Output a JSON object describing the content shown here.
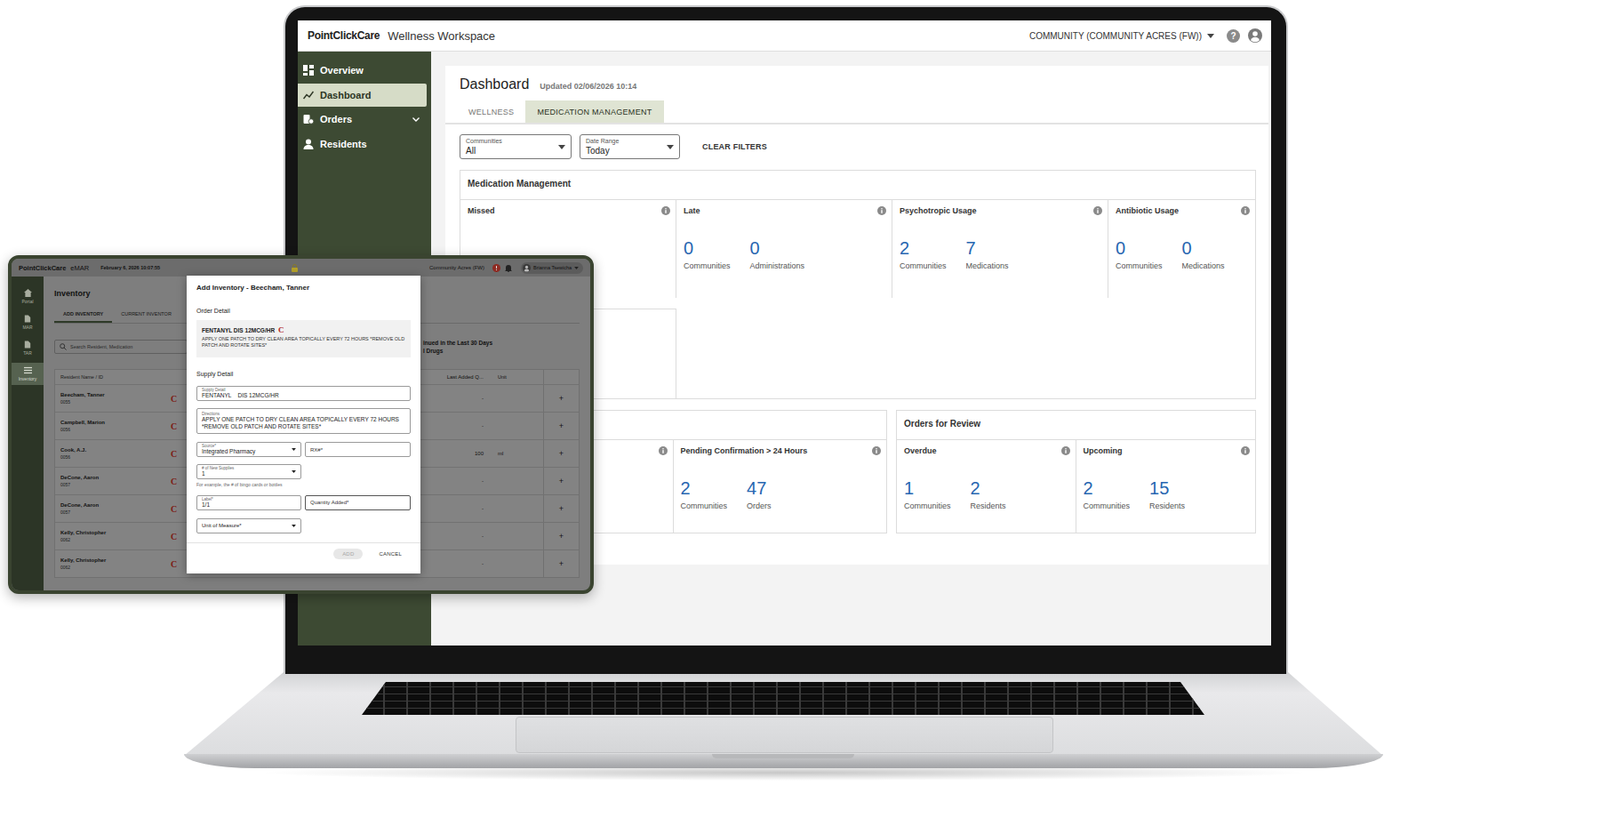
{
  "laptop": {
    "topbar": {
      "brand": "PointClickCare",
      "app": "Wellness Workspace",
      "community": "COMMUNITY (COMMUNITY ACRES (FW))",
      "help": "?"
    },
    "sidebar": {
      "items": [
        {
          "label": "Overview",
          "selected": false,
          "expandable": false
        },
        {
          "label": "Dashboard",
          "selected": true,
          "expandable": false
        },
        {
          "label": "Orders",
          "selected": false,
          "expandable": true
        },
        {
          "label": "Residents",
          "selected": false,
          "expandable": false
        }
      ]
    },
    "dashboard": {
      "title": "Dashboard",
      "updated": "Updated 02/06/2026 10:14",
      "tabs": [
        {
          "label": "WELLNESS",
          "selected": false
        },
        {
          "label": "MEDICATION MANAGEMENT",
          "selected": true
        }
      ],
      "filters": [
        {
          "label": "Communities",
          "value": "All"
        },
        {
          "label": "Date Range",
          "value": "Today"
        }
      ],
      "clear_filters": "CLEAR FILTERS",
      "medication_card": {
        "title": "Medication Management",
        "metrics": [
          {
            "title": "Missed",
            "stats": []
          },
          {
            "title": "Late",
            "stats": [
              {
                "value": "0",
                "label": "Communities"
              },
              {
                "value": "0",
                "label": "Administrations"
              }
            ]
          },
          {
            "title": "Psychotropic Usage",
            "stats": [
              {
                "value": "2",
                "label": "Communities"
              },
              {
                "value": "7",
                "label": "Medications"
              }
            ]
          },
          {
            "title": "Antibiotic Usage",
            "stats": [
              {
                "value": "0",
                "label": "Communities"
              },
              {
                "value": "0",
                "label": "Medications"
              }
            ]
          }
        ]
      },
      "pending_card": {
        "metrics": [
          {
            "title": "Pending Confirmation > 24 Hours",
            "stats": [
              {
                "value": "2",
                "label": "Communities"
              },
              {
                "value": "47",
                "label": "Orders"
              }
            ]
          }
        ]
      },
      "orders_card": {
        "title": "Orders for Review",
        "metrics": [
          {
            "title": "Overdue",
            "stats": [
              {
                "value": "1",
                "label": "Communities"
              },
              {
                "value": "2",
                "label": "Residents"
              }
            ]
          },
          {
            "title": "Upcoming",
            "stats": [
              {
                "value": "2",
                "label": "Communities"
              },
              {
                "value": "15",
                "label": "Residents"
              }
            ]
          }
        ]
      }
    }
  },
  "tablet": {
    "header": {
      "brand": "PointClickCare",
      "app": "eMAR",
      "datetime": "February 6, 2026 10:07:55",
      "community": "Community Acres (FW)",
      "user": "Brianna Tsewicha"
    },
    "rail": [
      {
        "label": "Portal",
        "selected": false
      },
      {
        "label": "MAR",
        "selected": false
      },
      {
        "label": "TAR",
        "selected": false
      },
      {
        "label": "Inventory",
        "selected": true
      }
    ],
    "title": "Inventory",
    "tabs": [
      {
        "label": "ADD INVENTORY",
        "selected": true
      },
      {
        "label": "CURRENT INVENTOR",
        "selected": false
      }
    ],
    "search": {
      "placeholder": "Search Resident, Medication"
    },
    "side_lines": [
      "inued in the Last 30 Days",
      "l Drugs"
    ],
    "table": {
      "columns": [
        "Resident Name / ID",
        "Last Added Q...",
        "Unit"
      ],
      "rows": [
        {
          "name": "Beecham, Tanner",
          "id": "0055",
          "controlled": "C",
          "last_added": "-",
          "unit": "",
          "action": "+"
        },
        {
          "name": "Campbell, Marion",
          "id": "0056",
          "controlled": "C",
          "last_added": "-",
          "unit": "",
          "action": "+"
        },
        {
          "name": "Cook, A.J.",
          "id": "0056",
          "controlled": "C",
          "last_added": "100",
          "unit": "ml",
          "action": "+"
        },
        {
          "name": "DeCone, Aaron",
          "id": "0057",
          "controlled": "C",
          "last_added": "-",
          "unit": "",
          "action": "+"
        },
        {
          "name": "DeCone, Aaron",
          "id": "0057",
          "controlled": "C",
          "last_added": "-",
          "unit": "",
          "action": "+"
        },
        {
          "name": "Kelly, Christopher",
          "id": "0062",
          "controlled": "C",
          "last_added": "-",
          "unit": "",
          "action": "+"
        },
        {
          "name": "Kelly, Christopher",
          "id": "0062",
          "controlled": "C",
          "last_added": "-",
          "unit": "",
          "action": "+"
        }
      ]
    },
    "modal": {
      "title": "Add Inventory - Beecham, Tanner",
      "order_section": "Order Detail",
      "order": {
        "drug": "FENTANYL DIS 12MCG/HR",
        "controlled": "C",
        "directions": "APPLY ONE PATCH TO DRY CLEAN AREA TOPICALLY EVERY 72 HOURS *REMOVE OLD PATCH AND ROTATE SITES*"
      },
      "supply_section": "Supply Detail",
      "supply_field": {
        "label": "Supply Detail",
        "value": "FENTANYL    DIS 12MCG/HR"
      },
      "directions_field": {
        "label": "Directions",
        "value": "APPLY ONE PATCH TO DRY CLEAN AREA TOPICALLY EVERY 72 HOURS *REMOVE OLD PATCH AND ROTATE SITES*"
      },
      "source_field": {
        "label": "Source*",
        "value": "Integrated Pharmacy"
      },
      "rx_field": {
        "placeholder": "RX#*"
      },
      "supplies_field": {
        "label": "# of New Supplies",
        "value": "1",
        "helper": "For example, the # of bingo cards or bottles"
      },
      "label_field": {
        "label": "Label*",
        "value": "1/1"
      },
      "quantity_field": {
        "placeholder": "Quantity Added*"
      },
      "unit_field": {
        "placeholder": "Unit of Measure*"
      },
      "buttons": [
        {
          "label": "ADD",
          "disabled": true
        },
        {
          "label": "CANCEL",
          "disabled": false
        }
      ]
    }
  }
}
